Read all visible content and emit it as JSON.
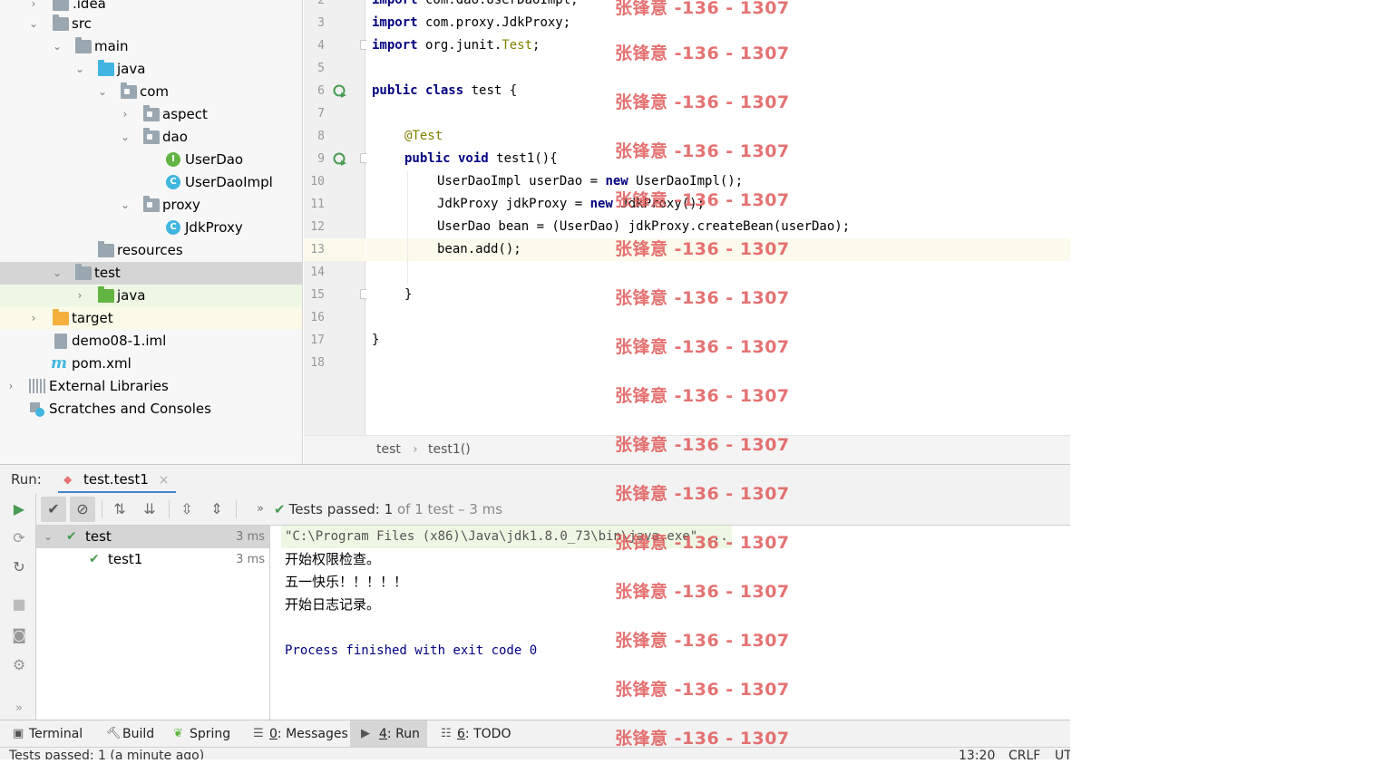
{
  "project_tree": {
    "items": [
      {
        "label": ".idea"
      },
      {
        "label": "src"
      },
      {
        "label": "main"
      },
      {
        "label": "java"
      },
      {
        "label": "com"
      },
      {
        "label": "aspect"
      },
      {
        "label": "dao"
      },
      {
        "label": "UserDao"
      },
      {
        "label": "UserDaoImpl"
      },
      {
        "label": "proxy"
      },
      {
        "label": "JdkProxy"
      },
      {
        "label": "resources"
      },
      {
        "label": "test"
      },
      {
        "label": "java"
      },
      {
        "label": "target"
      },
      {
        "label": "demo08-1.iml"
      },
      {
        "label": "pom.xml"
      },
      {
        "label": "External Libraries"
      },
      {
        "label": "Scratches and Consoles"
      }
    ],
    "selected": "test"
  },
  "editor": {
    "line_numbers": [
      "2",
      "3",
      "4",
      "5",
      "6",
      "7",
      "8",
      "9",
      "10",
      "11",
      "12",
      "13",
      "14",
      "15",
      "16",
      "17",
      "18"
    ],
    "current_line": "13",
    "lines": {
      "l2": {
        "kw": "import",
        "rest": " com.dao.UserDaoImpl;"
      },
      "l3": {
        "kw": "import",
        "rest": " com.proxy.JdkProxy;"
      },
      "l4": {
        "kw": "import",
        "rest": " org.junit.",
        "ann": "Test",
        "tail": ";"
      },
      "l6": {
        "kw": "public class",
        "rest": " test {"
      },
      "l8": {
        "ann": "@Test"
      },
      "l9": {
        "kw": "public void",
        "rest": " test1(){"
      },
      "l10": {
        "pre": "UserDaoImpl userDao = ",
        "kw": "new",
        "rest": " UserDaoImpl();"
      },
      "l11": {
        "pre": "JdkProxy jdkProxy = ",
        "kw": "new",
        "rest": " JdkProxy();"
      },
      "l12": {
        "text": "UserDao bean = (UserDao) jdkProxy.createBean(userDao);"
      },
      "l13": {
        "text": "bean.add();"
      },
      "l15": {
        "text": "}"
      },
      "l17": {
        "text": "}"
      }
    },
    "breadcrumbs": [
      "test",
      "test1()"
    ],
    "breadcrumb_sep": "›"
  },
  "run_panel": {
    "title": "Run:",
    "tab_label": "test.test1",
    "close_glyph": "×",
    "status": {
      "label": "Tests passed:",
      "count": "1",
      "detail": "of 1 test – 3 ms"
    },
    "more_glyph": "»",
    "test_tree": [
      {
        "label": "test",
        "time": "3 ms"
      },
      {
        "label": "test1",
        "time": "3 ms"
      }
    ],
    "console": {
      "command": "\"C:\\Program Files (x86)\\Java\\jdk1.8.0_73\\bin\\java.exe\" ...",
      "output": [
        "开始权限检查。",
        "五一快乐！！！！！",
        "开始日志记录。"
      ],
      "exit": "Process finished with exit code 0"
    }
  },
  "tool_strip": {
    "items": [
      {
        "label": "Terminal",
        "icon": "terminal-icon"
      },
      {
        "label": "Build",
        "icon": "hammer-icon"
      },
      {
        "label": "Spring",
        "icon": "spring-leaf-icon"
      },
      {
        "num": "0",
        "label": ": Messages",
        "icon": "messages-icon"
      },
      {
        "num": "4",
        "label": ": Run",
        "icon": "run-triangle-icon"
      },
      {
        "num": "6",
        "label": ": TODO",
        "icon": "todo-list-icon"
      }
    ]
  },
  "status_bar": {
    "message": "Tests passed: 1 (a minute ago)",
    "position": "13:20",
    "line_sep": "CRLF",
    "encoding": "UT"
  },
  "watermark": "张锋意 -136 - 1307",
  "colors": {
    "accent": "#4083c9",
    "keyword": "#000080",
    "annotation": "#808000",
    "pass_green": "#499c54",
    "watermark": "#e15a5a"
  }
}
